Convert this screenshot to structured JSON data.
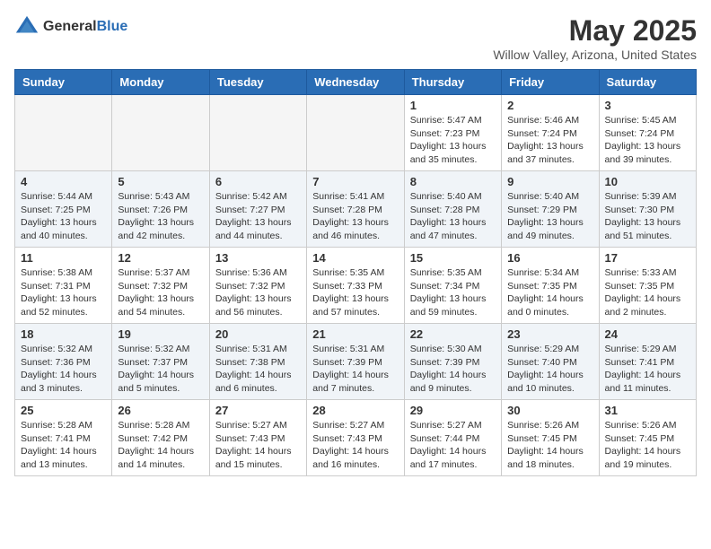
{
  "logo": {
    "text_general": "General",
    "text_blue": "Blue"
  },
  "title": "May 2025",
  "location": "Willow Valley, Arizona, United States",
  "weekdays": [
    "Sunday",
    "Monday",
    "Tuesday",
    "Wednesday",
    "Thursday",
    "Friday",
    "Saturday"
  ],
  "weeks": [
    [
      {
        "day": "",
        "empty": true
      },
      {
        "day": "",
        "empty": true
      },
      {
        "day": "",
        "empty": true
      },
      {
        "day": "",
        "empty": true
      },
      {
        "day": "1",
        "sunrise": "Sunrise: 5:47 AM",
        "sunset": "Sunset: 7:23 PM",
        "daylight": "Daylight: 13 hours and 35 minutes."
      },
      {
        "day": "2",
        "sunrise": "Sunrise: 5:46 AM",
        "sunset": "Sunset: 7:24 PM",
        "daylight": "Daylight: 13 hours and 37 minutes."
      },
      {
        "day": "3",
        "sunrise": "Sunrise: 5:45 AM",
        "sunset": "Sunset: 7:24 PM",
        "daylight": "Daylight: 13 hours and 39 minutes."
      }
    ],
    [
      {
        "day": "4",
        "sunrise": "Sunrise: 5:44 AM",
        "sunset": "Sunset: 7:25 PM",
        "daylight": "Daylight: 13 hours and 40 minutes."
      },
      {
        "day": "5",
        "sunrise": "Sunrise: 5:43 AM",
        "sunset": "Sunset: 7:26 PM",
        "daylight": "Daylight: 13 hours and 42 minutes."
      },
      {
        "day": "6",
        "sunrise": "Sunrise: 5:42 AM",
        "sunset": "Sunset: 7:27 PM",
        "daylight": "Daylight: 13 hours and 44 minutes."
      },
      {
        "day": "7",
        "sunrise": "Sunrise: 5:41 AM",
        "sunset": "Sunset: 7:28 PM",
        "daylight": "Daylight: 13 hours and 46 minutes."
      },
      {
        "day": "8",
        "sunrise": "Sunrise: 5:40 AM",
        "sunset": "Sunset: 7:28 PM",
        "daylight": "Daylight: 13 hours and 47 minutes."
      },
      {
        "day": "9",
        "sunrise": "Sunrise: 5:40 AM",
        "sunset": "Sunset: 7:29 PM",
        "daylight": "Daylight: 13 hours and 49 minutes."
      },
      {
        "day": "10",
        "sunrise": "Sunrise: 5:39 AM",
        "sunset": "Sunset: 7:30 PM",
        "daylight": "Daylight: 13 hours and 51 minutes."
      }
    ],
    [
      {
        "day": "11",
        "sunrise": "Sunrise: 5:38 AM",
        "sunset": "Sunset: 7:31 PM",
        "daylight": "Daylight: 13 hours and 52 minutes."
      },
      {
        "day": "12",
        "sunrise": "Sunrise: 5:37 AM",
        "sunset": "Sunset: 7:32 PM",
        "daylight": "Daylight: 13 hours and 54 minutes."
      },
      {
        "day": "13",
        "sunrise": "Sunrise: 5:36 AM",
        "sunset": "Sunset: 7:32 PM",
        "daylight": "Daylight: 13 hours and 56 minutes."
      },
      {
        "day": "14",
        "sunrise": "Sunrise: 5:35 AM",
        "sunset": "Sunset: 7:33 PM",
        "daylight": "Daylight: 13 hours and 57 minutes."
      },
      {
        "day": "15",
        "sunrise": "Sunrise: 5:35 AM",
        "sunset": "Sunset: 7:34 PM",
        "daylight": "Daylight: 13 hours and 59 minutes."
      },
      {
        "day": "16",
        "sunrise": "Sunrise: 5:34 AM",
        "sunset": "Sunset: 7:35 PM",
        "daylight": "Daylight: 14 hours and 0 minutes."
      },
      {
        "day": "17",
        "sunrise": "Sunrise: 5:33 AM",
        "sunset": "Sunset: 7:35 PM",
        "daylight": "Daylight: 14 hours and 2 minutes."
      }
    ],
    [
      {
        "day": "18",
        "sunrise": "Sunrise: 5:32 AM",
        "sunset": "Sunset: 7:36 PM",
        "daylight": "Daylight: 14 hours and 3 minutes."
      },
      {
        "day": "19",
        "sunrise": "Sunrise: 5:32 AM",
        "sunset": "Sunset: 7:37 PM",
        "daylight": "Daylight: 14 hours and 5 minutes."
      },
      {
        "day": "20",
        "sunrise": "Sunrise: 5:31 AM",
        "sunset": "Sunset: 7:38 PM",
        "daylight": "Daylight: 14 hours and 6 minutes."
      },
      {
        "day": "21",
        "sunrise": "Sunrise: 5:31 AM",
        "sunset": "Sunset: 7:39 PM",
        "daylight": "Daylight: 14 hours and 7 minutes."
      },
      {
        "day": "22",
        "sunrise": "Sunrise: 5:30 AM",
        "sunset": "Sunset: 7:39 PM",
        "daylight": "Daylight: 14 hours and 9 minutes."
      },
      {
        "day": "23",
        "sunrise": "Sunrise: 5:29 AM",
        "sunset": "Sunset: 7:40 PM",
        "daylight": "Daylight: 14 hours and 10 minutes."
      },
      {
        "day": "24",
        "sunrise": "Sunrise: 5:29 AM",
        "sunset": "Sunset: 7:41 PM",
        "daylight": "Daylight: 14 hours and 11 minutes."
      }
    ],
    [
      {
        "day": "25",
        "sunrise": "Sunrise: 5:28 AM",
        "sunset": "Sunset: 7:41 PM",
        "daylight": "Daylight: 14 hours and 13 minutes."
      },
      {
        "day": "26",
        "sunrise": "Sunrise: 5:28 AM",
        "sunset": "Sunset: 7:42 PM",
        "daylight": "Daylight: 14 hours and 14 minutes."
      },
      {
        "day": "27",
        "sunrise": "Sunrise: 5:27 AM",
        "sunset": "Sunset: 7:43 PM",
        "daylight": "Daylight: 14 hours and 15 minutes."
      },
      {
        "day": "28",
        "sunrise": "Sunrise: 5:27 AM",
        "sunset": "Sunset: 7:43 PM",
        "daylight": "Daylight: 14 hours and 16 minutes."
      },
      {
        "day": "29",
        "sunrise": "Sunrise: 5:27 AM",
        "sunset": "Sunset: 7:44 PM",
        "daylight": "Daylight: 14 hours and 17 minutes."
      },
      {
        "day": "30",
        "sunrise": "Sunrise: 5:26 AM",
        "sunset": "Sunset: 7:45 PM",
        "daylight": "Daylight: 14 hours and 18 minutes."
      },
      {
        "day": "31",
        "sunrise": "Sunrise: 5:26 AM",
        "sunset": "Sunset: 7:45 PM",
        "daylight": "Daylight: 14 hours and 19 minutes."
      }
    ]
  ]
}
